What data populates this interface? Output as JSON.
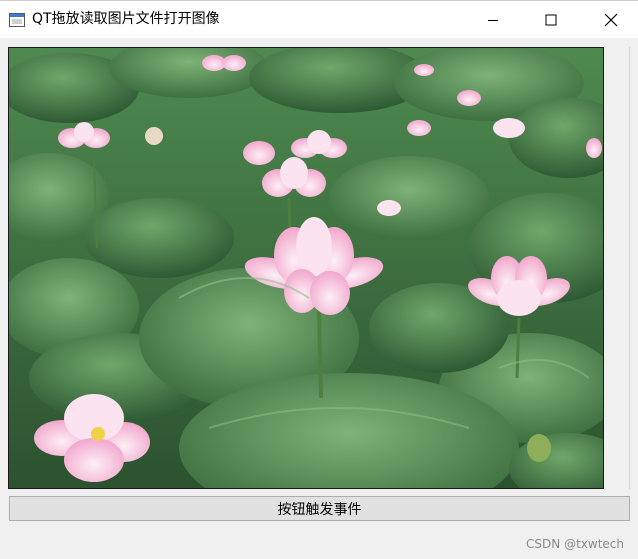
{
  "window": {
    "title": "QT拖放读取图片文件打开图像",
    "app_icon": "qt-window-icon",
    "controls": {
      "minimize_icon": "minimize-icon",
      "maximize_icon": "maximize-icon",
      "close_icon": "close-icon"
    }
  },
  "image_view": {
    "content": "lotus-flowers-photo",
    "colors": {
      "leaf_dark": "#2f5a34",
      "leaf_light": "#5c9a5a",
      "petal": "#f4b9d8",
      "petal_light": "#fbe3ef"
    }
  },
  "controls": {
    "trigger_button_label": "按钮触发事件"
  },
  "footer": {
    "watermark": "CSDN @txwtech"
  }
}
